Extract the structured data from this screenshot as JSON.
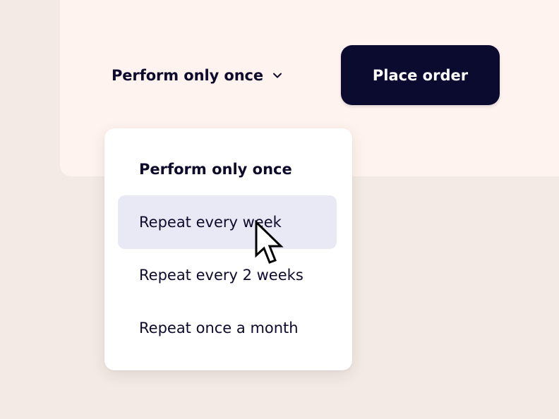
{
  "frequency_select": {
    "value": "Perform only once",
    "icon": "chevron-down-icon"
  },
  "place_order": {
    "label": "Place order"
  },
  "menu": {
    "items": [
      {
        "label": "Perform only once",
        "selected": true,
        "hovered": false
      },
      {
        "label": "Repeat every week",
        "selected": false,
        "hovered": true
      },
      {
        "label": "Repeat every 2 weeks",
        "selected": false,
        "hovered": false
      },
      {
        "label": "Repeat once a month",
        "selected": false,
        "hovered": false
      }
    ]
  },
  "colors": {
    "background": "#f3eae5",
    "panel": "#fff3ef",
    "primary": "#0b0a2f",
    "text": "#0d0a2c",
    "hover": "#e9e9f5"
  },
  "cursor": {
    "icon": "pointer-cursor-icon"
  }
}
